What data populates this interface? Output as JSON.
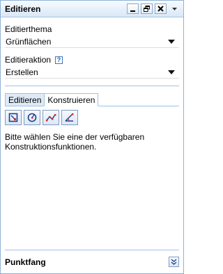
{
  "window": {
    "title": "Editieren",
    "controls": [
      "minimize-icon",
      "restore-icon",
      "close-icon",
      "dropdown-icon"
    ]
  },
  "edit_theme": {
    "label": "Editierthema",
    "value": "Grünflächen"
  },
  "edit_action": {
    "label": "Editieraktion",
    "help_glyph": "?",
    "value": "Erstellen"
  },
  "tabs": [
    {
      "label": "Editieren",
      "active": false
    },
    {
      "label": "Konstruieren",
      "active": true
    }
  ],
  "tools": [
    "construct-rectangle-icon",
    "construct-circle-icon",
    "construct-line-icon",
    "construct-angle-icon"
  ],
  "message": "Bitte wählen Sie eine der verfügbaren Konstruktionsfunktionen.",
  "footer": {
    "title": "Punktfang",
    "expand_icon": "double-chevron-down-icon"
  },
  "colors": {
    "accent": "#9ec0e6",
    "titlebar": "#d9e7f6"
  }
}
